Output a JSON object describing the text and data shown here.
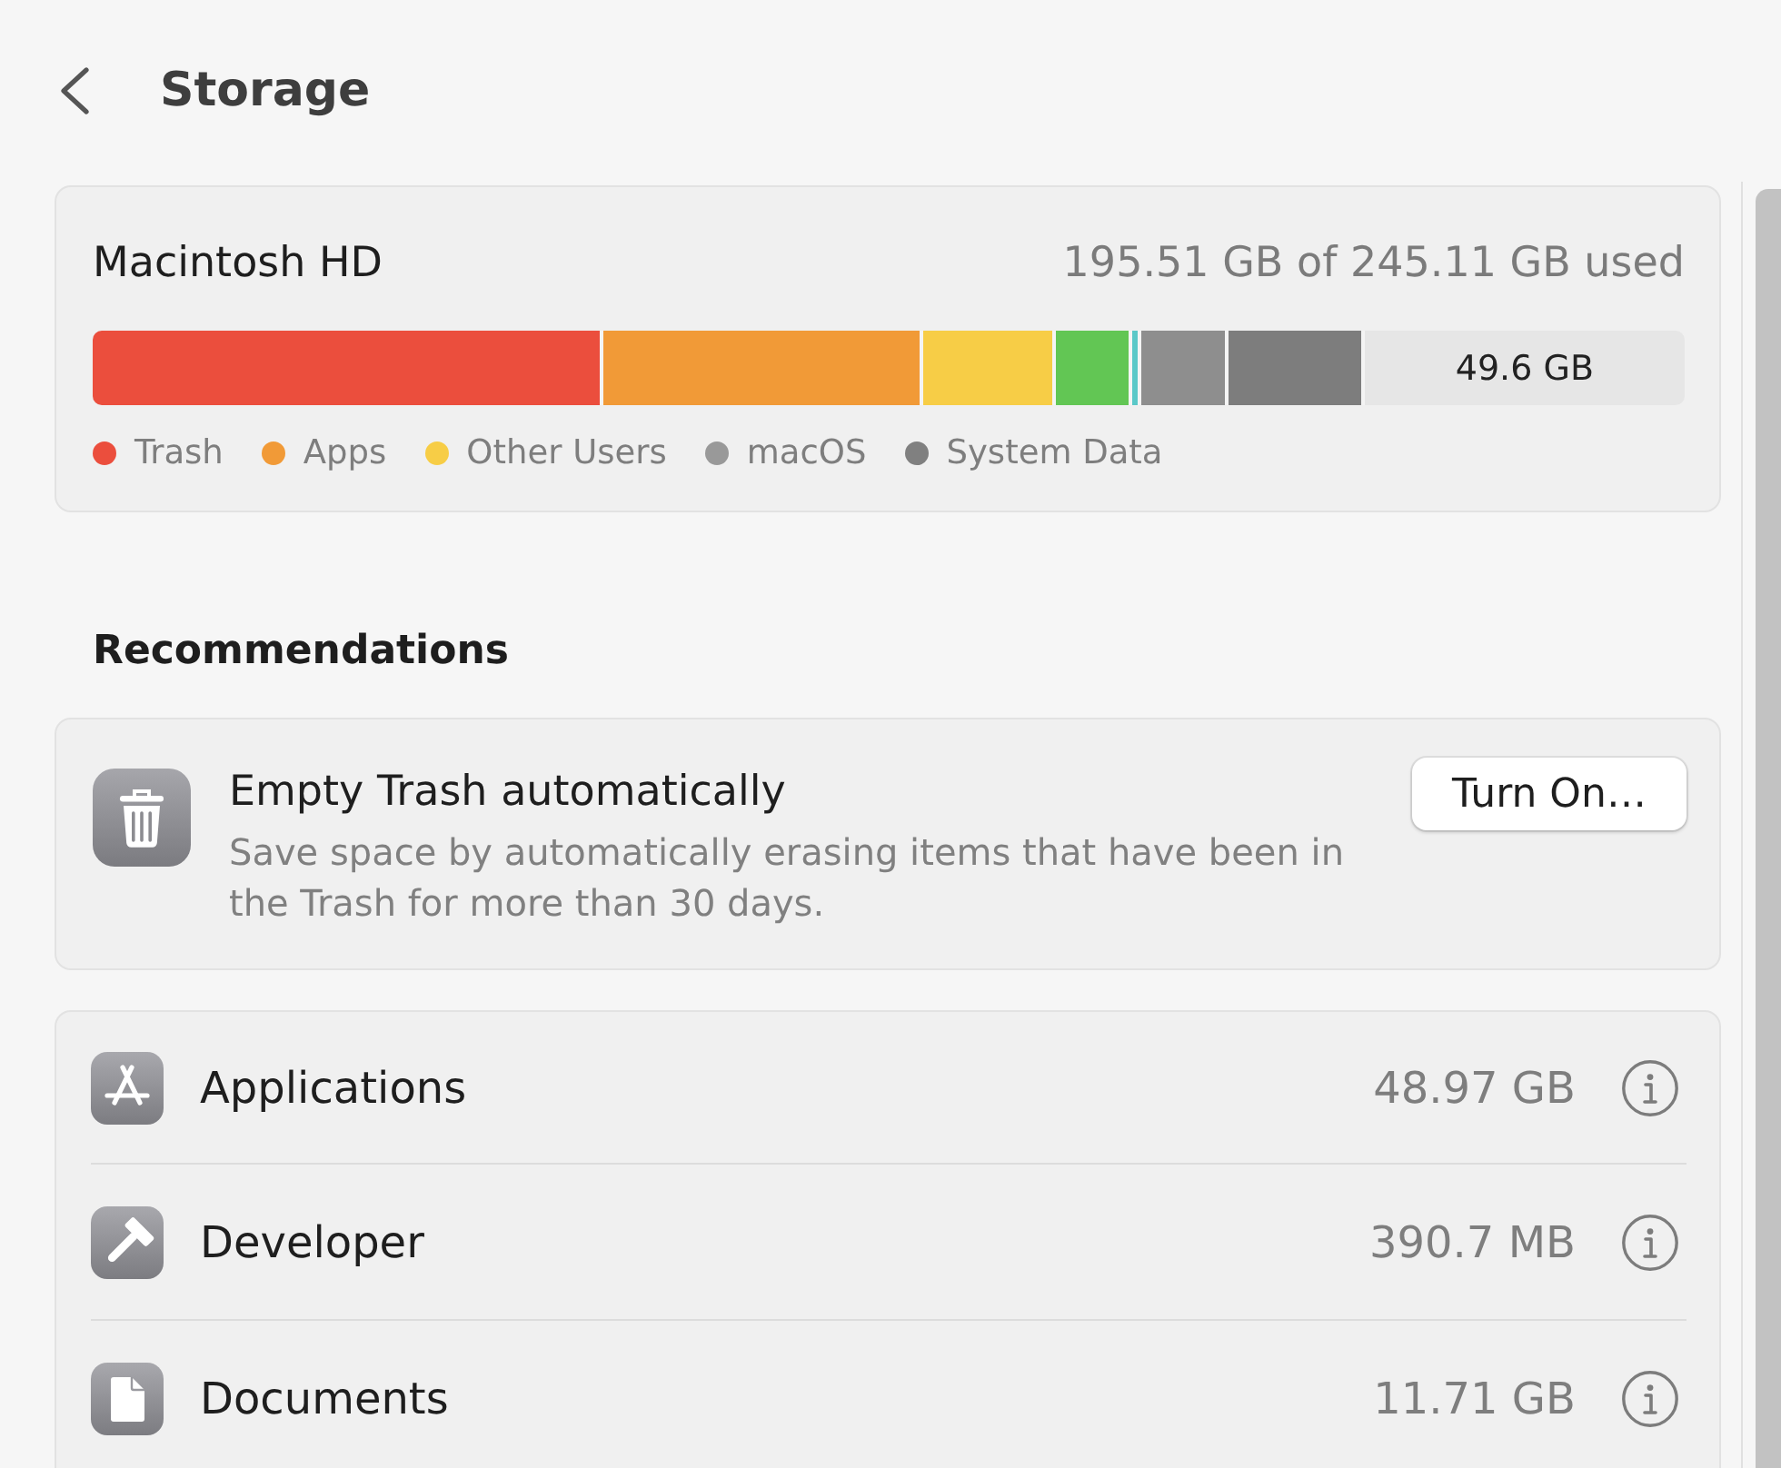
{
  "header": {
    "title": "Storage"
  },
  "disk": {
    "name": "Macintosh HD",
    "usage": "195.51 GB of 245.11 GB used",
    "segments": [
      {
        "color": "#eb4e3d"
      },
      {
        "color": "#f19a37"
      },
      {
        "color": "#f7cd46"
      },
      {
        "color": "#62c654"
      },
      {
        "color": "#5ac8c8"
      },
      {
        "color": "#8e8e8e"
      },
      {
        "color": "#7d7d7d"
      }
    ],
    "free_label": "49.6 GB",
    "legend": [
      {
        "label": "Trash",
        "color": "#eb4e3d"
      },
      {
        "label": "Apps",
        "color": "#f19a37"
      },
      {
        "label": "Other Users",
        "color": "#f7cd46"
      },
      {
        "label": "macOS",
        "color": "#999999"
      },
      {
        "label": "System Data",
        "color": "#808080"
      }
    ]
  },
  "recommendations": {
    "heading": "Recommendations",
    "items": [
      {
        "title": "Empty Trash automatically",
        "description": "Save space by automatically erasing items that have been in the Trash for more than 30 days.",
        "button": "Turn On…"
      }
    ]
  },
  "categories": [
    {
      "kind": "applications",
      "name": "Applications",
      "size": "48.97 GB"
    },
    {
      "kind": "developer",
      "name": "Developer",
      "size": "390.7 MB"
    },
    {
      "kind": "documents",
      "name": "Documents",
      "size": "11.71 GB"
    }
  ]
}
